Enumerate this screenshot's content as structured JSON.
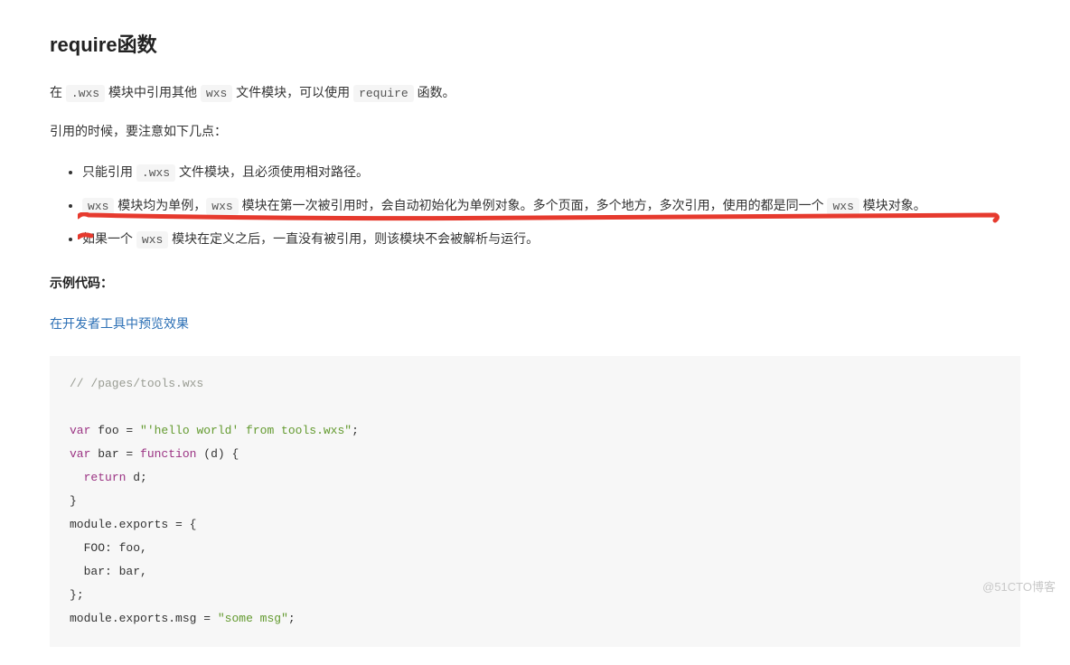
{
  "heading": "require函数",
  "para1": {
    "prefix": "在 ",
    "code1": ".wxs",
    "mid1": " 模块中引用其他 ",
    "code2": "wxs",
    "mid2": " 文件模块，可以使用 ",
    "code3": "require",
    "suffix": " 函数。"
  },
  "para2": "引用的时候，要注意如下几点：",
  "bullets": [
    {
      "t0": "只能引用 ",
      "c0": ".wxs",
      "t1": " 文件模块，且必须使用相对路径。"
    },
    {
      "c0": "wxs",
      "t0": " 模块均为单例，",
      "c1": "wxs",
      "t1": " 模块在第一次被引用时，会自动初始化为单例对象。多个页面，多个地方，多次引用，使用的都是同一个 ",
      "c2": "wxs",
      "t2": " 模块对象。"
    },
    {
      "t0": "如果一个 ",
      "c0": "wxs",
      "t1": " 模块在定义之后，一直没有被引用，则该模块不会被解析与运行。"
    }
  ],
  "example_label": "示例代码：",
  "preview_link_text": "在开发者工具中预览效果",
  "code": {
    "comment": "// /pages/tools.wxs",
    "kw_var": "var",
    "kw_function": "function",
    "kw_return": "return",
    "ident_foo": "foo",
    "ident_bar": "bar",
    "ident_d": "d",
    "ident_module": "module",
    "ident_exports": "exports",
    "ident_msg": "msg",
    "ident_FOO": "FOO",
    "str_foo": "\"'hello world' from tools.wxs\"",
    "str_msg": "\"some msg\"",
    "eq": " = ",
    "dot": ".",
    "semi": ";",
    "colon": ": ",
    "comma": ",",
    "lparen": "(",
    "rparen": ")",
    "lbrace": "{",
    "rbrace": "}",
    "sp2": "  "
  },
  "watermark": "@51CTO博客"
}
